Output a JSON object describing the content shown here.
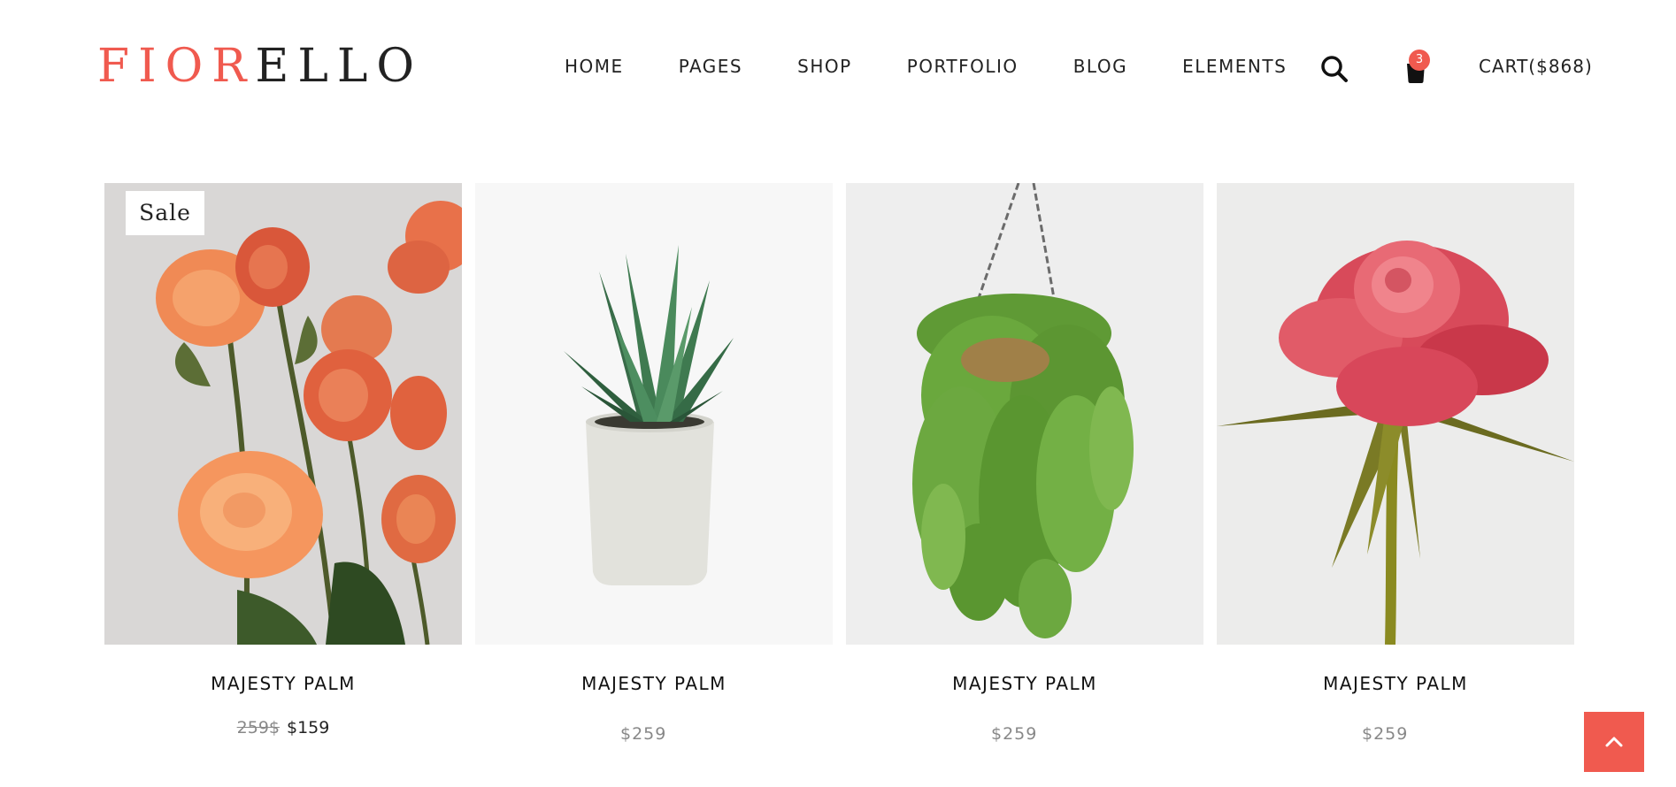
{
  "brand": {
    "logo_accent": "FIOR",
    "logo_rest": "ELLO",
    "accent_color": "#f05a4f"
  },
  "nav": {
    "items": [
      {
        "label": "HOME"
      },
      {
        "label": "PAGES"
      },
      {
        "label": "SHOP"
      },
      {
        "label": "PORTFOLIO"
      },
      {
        "label": "BLOG"
      },
      {
        "label": "ELEMENTS"
      }
    ],
    "search_icon": "search-icon",
    "cart_icon": "shopping-bag-icon",
    "cart_count": "3",
    "cart_label": "CART($868)"
  },
  "products": [
    {
      "name": "MAJESTY PALM",
      "badge": "Sale",
      "old_price": "259$",
      "price": "$159",
      "image": "orange-roses"
    },
    {
      "name": "MAJESTY PALM",
      "price": "$259",
      "image": "aloe-in-concrete-pot"
    },
    {
      "name": "MAJESTY PALM",
      "price": "$259",
      "image": "hanging-fern-basket"
    },
    {
      "name": "MAJESTY PALM",
      "price": "$259",
      "image": "red-rose"
    }
  ],
  "back_to_top_icon": "chevron-up-icon"
}
